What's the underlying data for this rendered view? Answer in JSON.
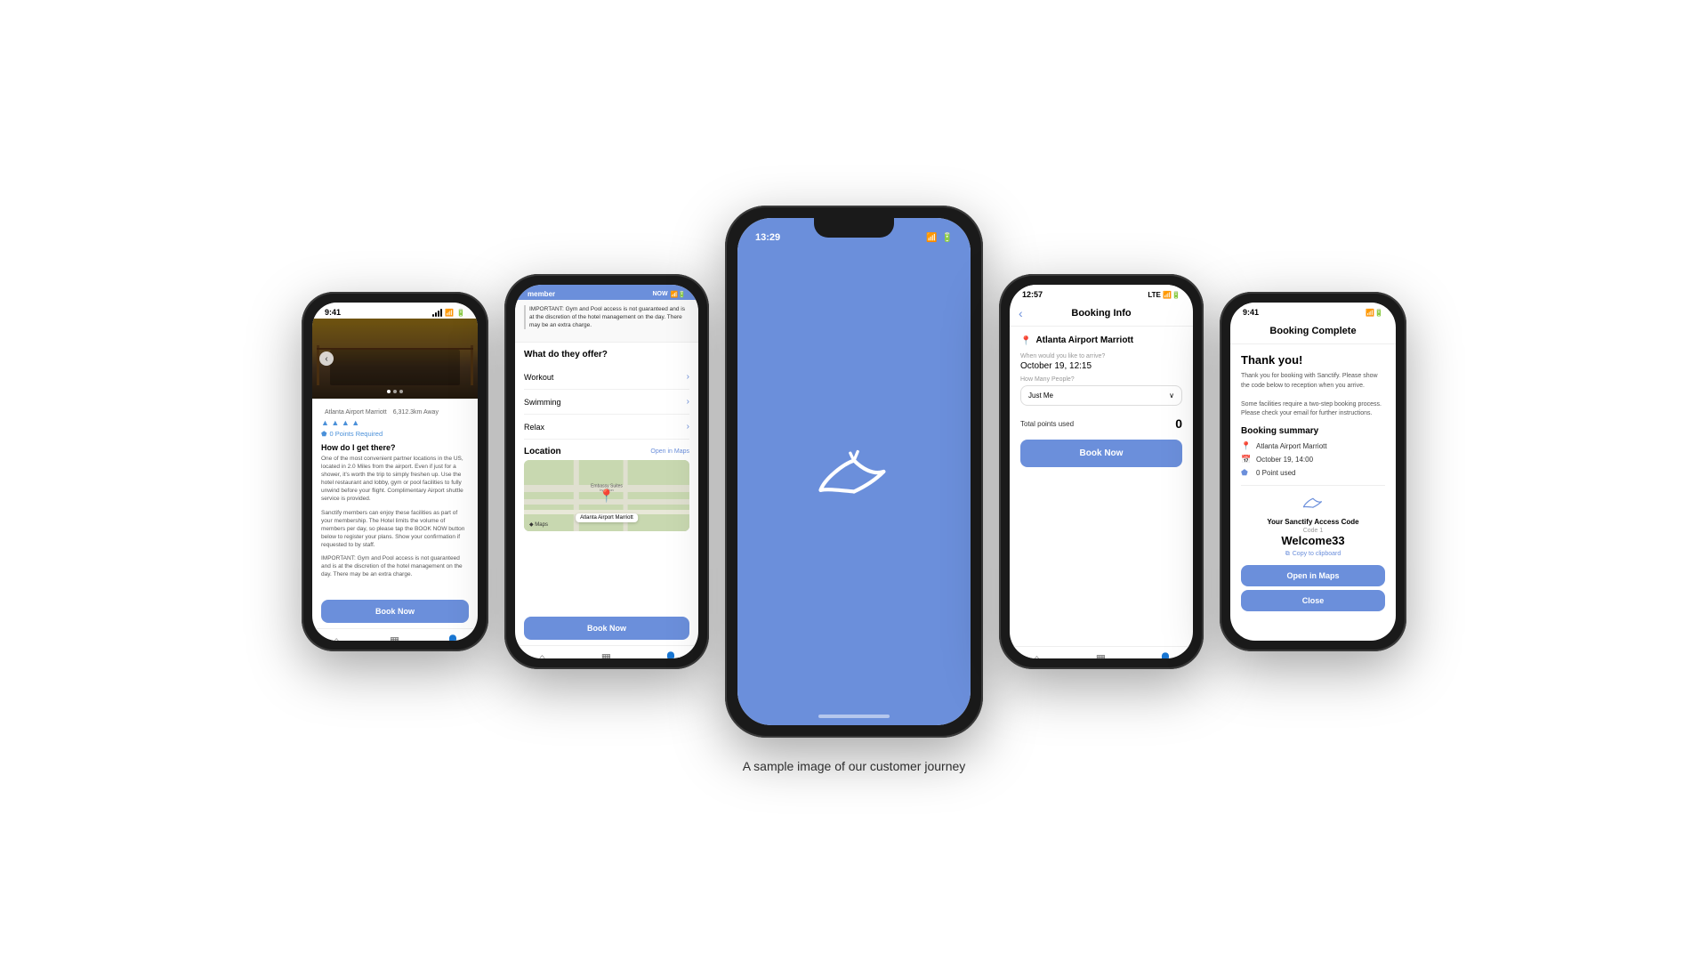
{
  "page": {
    "caption": "A sample image of our customer journey",
    "background": "#ffffff"
  },
  "phone1": {
    "hotel_name": "Atlanta Airport Marriott",
    "hotel_distance": "6,312.3km Away",
    "stars": "▲ ▲ ▲ ▲",
    "points_required": "0 Points Required",
    "how_to_get": "How do I get there?",
    "directions_text": "One of the most convenient partner locations in the US, located in 2.0 Miles from the airport. Even if just for a shower, it's worth the trip to simply freshen up. Use the hotel restaurant and lobby, gym or pool facilities to fully unwind before your flight. Complimentary Airport shuttle service is provided.",
    "member_text": "Sanctify members can enjoy these facilities as part of your membership. The Hotel limits the volume of members per day, so please tap the BOOK NOW button below to register your plans. Show your confirmation if requested to by staff.",
    "important_text": "IMPORTANT: Gym and Pool access is not guaranteed and is at the discretion of the hotel management on the day. There may be an extra charge.",
    "book_button": "Book Now",
    "nav_home": "Home",
    "nav_access": "Access Codes",
    "nav_profile": "Profile"
  },
  "phone2": {
    "header_member": "member",
    "header_button": "NOW",
    "important_text": "IMPORTANT: Gym and Pool access is not guaranteed and is at the discretion of the hotel management on the day. There may be an extra charge.",
    "what_do_they_offer": "What do they offer?",
    "amenity1": "Workout",
    "amenity2": "Swimming",
    "amenity3": "Relax",
    "location_title": "Location",
    "open_in_maps": "Open in Maps",
    "map_label": "Atlanta Airport Marriott",
    "apple_maps": "◆ Maps",
    "book_button": "Book Now",
    "nav_home": "Home",
    "nav_access": "Access Codes",
    "nav_profile": "Profile"
  },
  "phone3": {
    "time": "13:29",
    "logo_alt": "Sanctify Logo"
  },
  "phone4": {
    "time": "12:57",
    "header_title": "Booking Info",
    "location_name": "Atlanta Airport Marriott",
    "arrive_label": "When would you like to arrive?",
    "arrive_value": "October 19, 12:15",
    "people_label": "How Many People?",
    "people_value": "Just Me",
    "total_points_label": "Total points used",
    "total_points_value": "0",
    "book_button": "Book Now",
    "nav_home": "Home",
    "nav_access": "Access Codes",
    "nav_profile": "Profile"
  },
  "phone5": {
    "header_title": "Booking Complete",
    "thank_you_title": "Thank you!",
    "thank_you_desc": "Thank you for booking with Sanctify. Please show the code below to reception when you arrive.\n\nSome facilities require a two-step booking process. Please check your email for further instructions.",
    "booking_summary_title": "Booking summary",
    "summary_location": "Atlanta Airport Marriott",
    "summary_date": "October 19, 14:00",
    "summary_points": "0 Point used",
    "access_code_title": "Your Sanctify Access Code",
    "code_label": "Code 1",
    "code_value": "Welcome33",
    "copy_label": "Copy to clipboard",
    "open_maps_btn": "Open in Maps",
    "close_btn": "Close"
  }
}
